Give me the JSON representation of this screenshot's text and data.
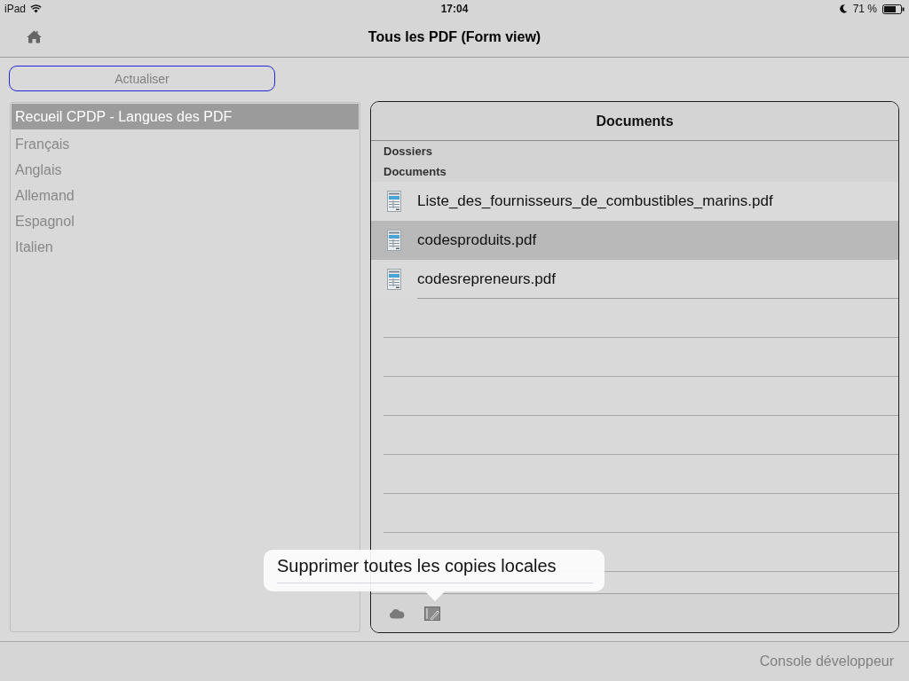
{
  "status_bar": {
    "device": "iPad",
    "time": "17:04",
    "battery": "71 %"
  },
  "nav_bar": {
    "title": "Tous les PDF (Form view)"
  },
  "refresh_button": {
    "label": "Actualiser"
  },
  "collection_list": {
    "items": [
      {
        "label": "Recueil CPDP - Langues des PDF",
        "selected": true
      },
      {
        "label": "Français",
        "selected": false
      },
      {
        "label": "Anglais",
        "selected": false
      },
      {
        "label": "Allemand",
        "selected": false
      },
      {
        "label": "Espagnol",
        "selected": false
      },
      {
        "label": "Italien",
        "selected": false
      }
    ]
  },
  "documents_panel": {
    "title": "Documents",
    "sections": [
      {
        "title": "Dossiers"
      },
      {
        "title": "Documents",
        "files": [
          {
            "name": "Liste_des_fournisseurs_de_combustibles_marins.pdf",
            "selected": false
          },
          {
            "name": "codesproduits.pdf",
            "selected": true
          },
          {
            "name": "codesrepreneurs.pdf",
            "selected": false
          }
        ]
      }
    ]
  },
  "popover": {
    "items": [
      "Supprimer toutes les copies locales"
    ]
  },
  "footer": {
    "link": "Console développeur"
  }
}
